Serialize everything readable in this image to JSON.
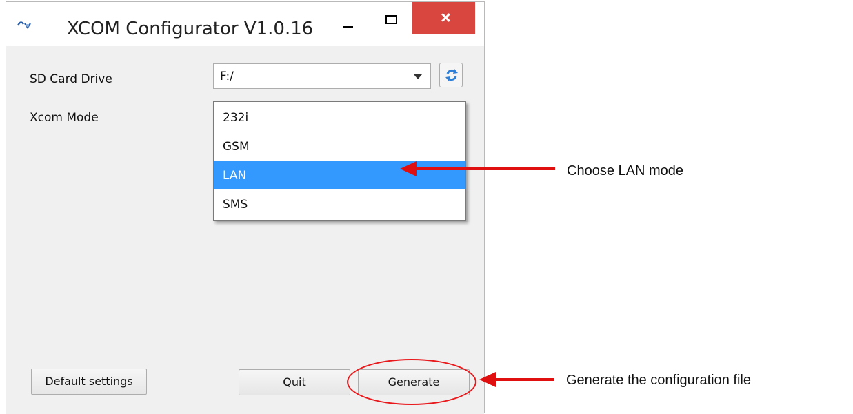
{
  "window": {
    "title": "XCOM Configurator V1.0.16",
    "controls": [
      "minimize-icon",
      "maximize-icon",
      "close-icon"
    ]
  },
  "form": {
    "sd_card_label": "SD Card Drive",
    "sd_card_value": "F:/",
    "mode_label": "Xcom Mode",
    "mode_options": [
      "232i",
      "GSM",
      "LAN",
      "SMS"
    ],
    "mode_selected": "LAN"
  },
  "buttons": {
    "default_settings": "Default settings",
    "quit": "Quit",
    "generate": "Generate"
  },
  "annotations": {
    "choose_mode": "Choose LAN mode",
    "generate_file": "Generate the configuration file"
  },
  "colors": {
    "selection": "#3399ff",
    "close_button": "#d9463f",
    "annotation_red": "#e01010"
  }
}
